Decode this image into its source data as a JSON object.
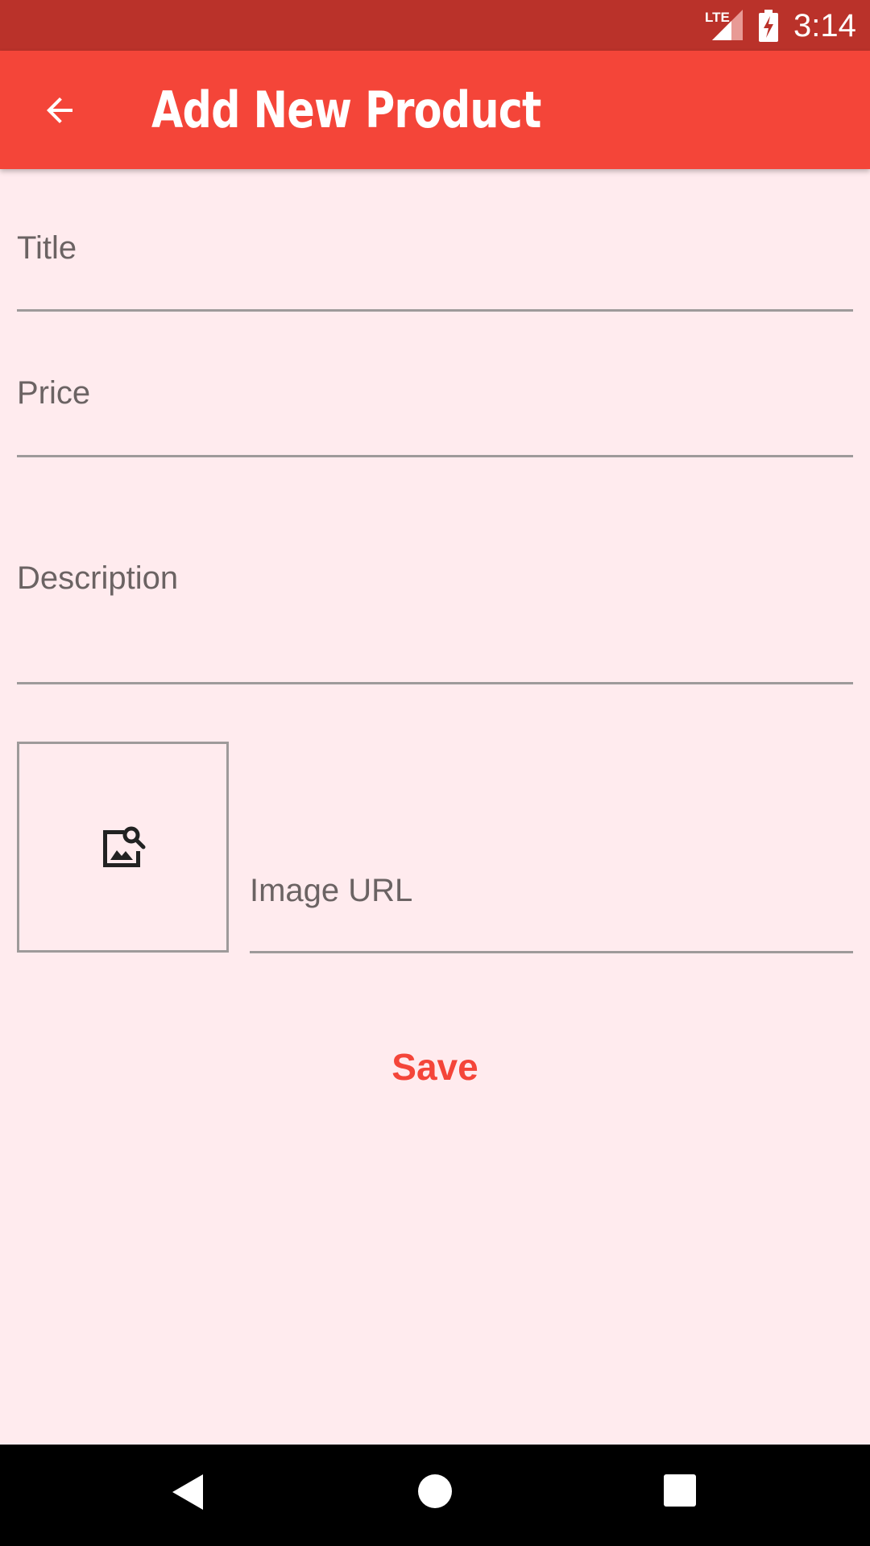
{
  "status_bar": {
    "network": "LTE",
    "time": "3:14"
  },
  "app_bar": {
    "title": "Add New Product"
  },
  "form": {
    "title_label": "Title",
    "price_label": "Price",
    "description_label": "Description",
    "image_url_label": "Image URL",
    "save_label": "Save"
  },
  "colors": {
    "status_bar": "#ba322a",
    "app_bar": "#f44539",
    "background": "#ffebee",
    "accent": "#f44539"
  },
  "icons": {
    "back": "arrow-back-icon",
    "image_preview": "image-search-icon",
    "nav_back": "triangle-back-icon",
    "nav_home": "circle-home-icon",
    "nav_recents": "square-recents-icon"
  }
}
